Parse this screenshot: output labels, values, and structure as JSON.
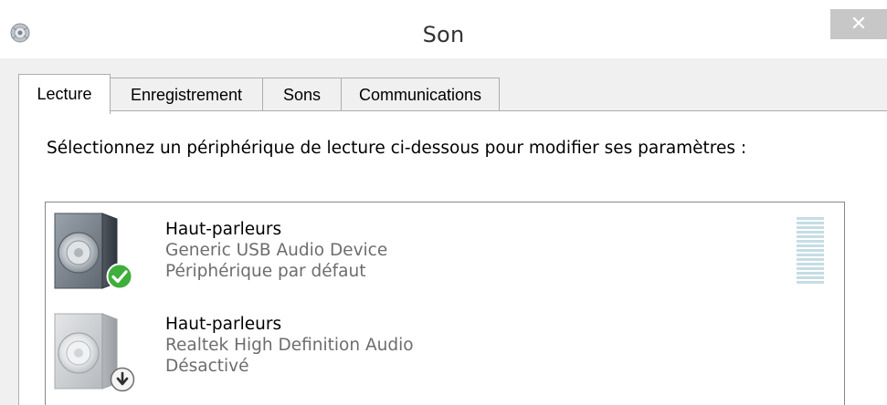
{
  "window": {
    "title": "Son",
    "close_glyph": "✕"
  },
  "tabs": [
    {
      "label": "Lecture",
      "active": true
    },
    {
      "label": "Enregistrement",
      "active": false
    },
    {
      "label": "Sons",
      "active": false
    },
    {
      "label": "Communications",
      "active": false
    }
  ],
  "panel": {
    "instruction": "Sélectionnez un périphérique de lecture ci-dessous pour modifier ses paramètres :"
  },
  "devices": [
    {
      "name": "Haut-parleurs",
      "driver": "Generic USB Audio Device",
      "status": "Périphérique par défaut",
      "status_icon": "green-check-icon",
      "is_default": true,
      "level_meter_bars": 15
    },
    {
      "name": "Haut-parleurs",
      "driver": "Realtek High Definition Audio",
      "status": "Désactivé",
      "status_icon": "disabled-arrow-icon",
      "is_default": false
    }
  ],
  "colors": {
    "accent_check": "#3fae3b",
    "level_meter": "#c5dde4",
    "close_button": "#c7c7c7"
  }
}
